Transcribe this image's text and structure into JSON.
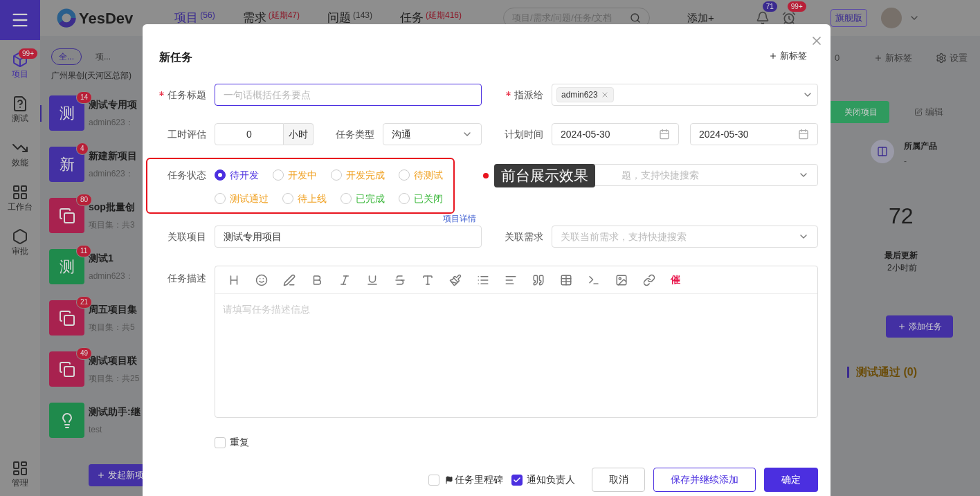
{
  "rail": {
    "items": [
      {
        "label": "项目",
        "badge": "99+",
        "selected": true
      },
      {
        "label": "测试",
        "selected": false
      },
      {
        "label": "效能",
        "selected": false
      },
      {
        "label": "工作台",
        "selected": false
      },
      {
        "label": "审批",
        "selected": false
      }
    ],
    "bottom": "管理"
  },
  "header": {
    "logo": "YesDev",
    "tabs": [
      {
        "label": "项目",
        "count": "(56)",
        "kind": "normal",
        "selected": true
      },
      {
        "label": "需求",
        "count": "(延期47)",
        "kind": "overdue",
        "selected": false
      },
      {
        "label": "问题",
        "count": "(143)",
        "kind": "normal",
        "selected": false
      },
      {
        "label": "任务",
        "count": "(延期416)",
        "kind": "overdue",
        "selected": false
      }
    ],
    "search": {
      "placeholder": "项目/需求/问题/任务/文档"
    },
    "add": "添加+",
    "bell_badge": "71",
    "clock_badge": "99+",
    "edition": "旗舰版"
  },
  "project_list": {
    "filters": [
      {
        "label": "全...",
        "selected": true
      },
      {
        "label": "项...",
        "selected": false
      }
    ],
    "breadcrumb": "广州果创(天河区总部)",
    "items": [
      {
        "kind": "letter",
        "glyph": "测",
        "color": "#4330a3",
        "badge": "14",
        "title": "测试专用项",
        "subtitle": "admin623：",
        "selected": true
      },
      {
        "kind": "letter",
        "glyph": "新",
        "color": "#4330a3",
        "badge": "4",
        "title": "新建新项目",
        "subtitle": "admin623：",
        "selected": false
      },
      {
        "kind": "set",
        "color": "#a8224f",
        "badge": "80",
        "title": "sop批量创",
        "subtitle": "项目集：共3",
        "selected": false
      },
      {
        "kind": "letter",
        "glyph": "测",
        "color": "#1f8a4c",
        "badge": "11",
        "title": "测试1",
        "subtitle": "admin623：",
        "selected": false
      },
      {
        "kind": "set",
        "color": "#a8224f",
        "badge": "21",
        "title": "周五项目集",
        "subtitle": "项目集：共5",
        "selected": false
      },
      {
        "kind": "set",
        "color": "#a8224f",
        "badge": "49",
        "title": "测试项目联",
        "subtitle": "项目集：共25",
        "selected": false
      },
      {
        "kind": "idea",
        "color": "#1f8a4c",
        "title": "测试助手:继",
        "subtitle": "test",
        "selected": false
      }
    ],
    "new_button": "发起新项"
  },
  "right_panel": {
    "count_fragment": "0",
    "new_tag": "新标签",
    "settings": "设置",
    "close_project": "关闭项目",
    "edit": "编辑",
    "product_label": "所属产品",
    "product_value": "-",
    "total": "72",
    "updated_label": "最后更新",
    "updated_value": "2小时前",
    "add_task": "添加任务",
    "column_title": "测试通过 (0)"
  },
  "modal": {
    "title": "新任务",
    "new_tag": "新标签",
    "task_title": {
      "label": "任务标题",
      "required": true,
      "placeholder": "一句话概括任务要点"
    },
    "assignee": {
      "label": "指派给",
      "required": true,
      "tags": [
        "admin623"
      ]
    },
    "estimate": {
      "label": "工时评估",
      "value": "0",
      "unit": "小时"
    },
    "task_type": {
      "label": "任务类型",
      "value": "沟通"
    },
    "plan_time": {
      "label": "计划时间",
      "start": "2024-05-30",
      "end": "2024-05-30"
    },
    "status": {
      "label": "任务状态",
      "options": [
        {
          "label": "待开发",
          "color": "#4b2fe0",
          "selected": true
        },
        {
          "label": "开发中",
          "color": "#f0a020",
          "selected": false
        },
        {
          "label": "开发完成",
          "color": "#f0a020",
          "selected": false
        },
        {
          "label": "待测试",
          "color": "#f0a020",
          "selected": false
        },
        {
          "label": "测试通过",
          "color": "#f0a020",
          "selected": false
        },
        {
          "label": "待上线",
          "color": "#f0a020",
          "selected": false
        },
        {
          "label": "已完成",
          "color": "#3cb83c",
          "selected": false
        },
        {
          "label": "已关闭",
          "color": "#3cb83c",
          "selected": false
        }
      ]
    },
    "related_issue": {
      "placeholder": "题，支持快捷搜索"
    },
    "annotation": "前台展示效果",
    "project_detail_link": "项目详情",
    "related_project": {
      "label": "关联项目",
      "value": "测试专用项目"
    },
    "related_requirement": {
      "label": "关联需求",
      "placeholder": "关联当前需求，支持快捷搜索"
    },
    "description": {
      "label": "任务描述",
      "urge": "催",
      "placeholder": "请填写任务描述信息"
    },
    "repeat": {
      "label": "重复",
      "checked": false
    },
    "footer": {
      "milestone": {
        "label": "任务里程碑",
        "checked": false
      },
      "notify": {
        "label": "通知负责人",
        "checked": true
      },
      "cancel": "取消",
      "save_continue": "保存并继续添加",
      "confirm": "确定"
    }
  }
}
